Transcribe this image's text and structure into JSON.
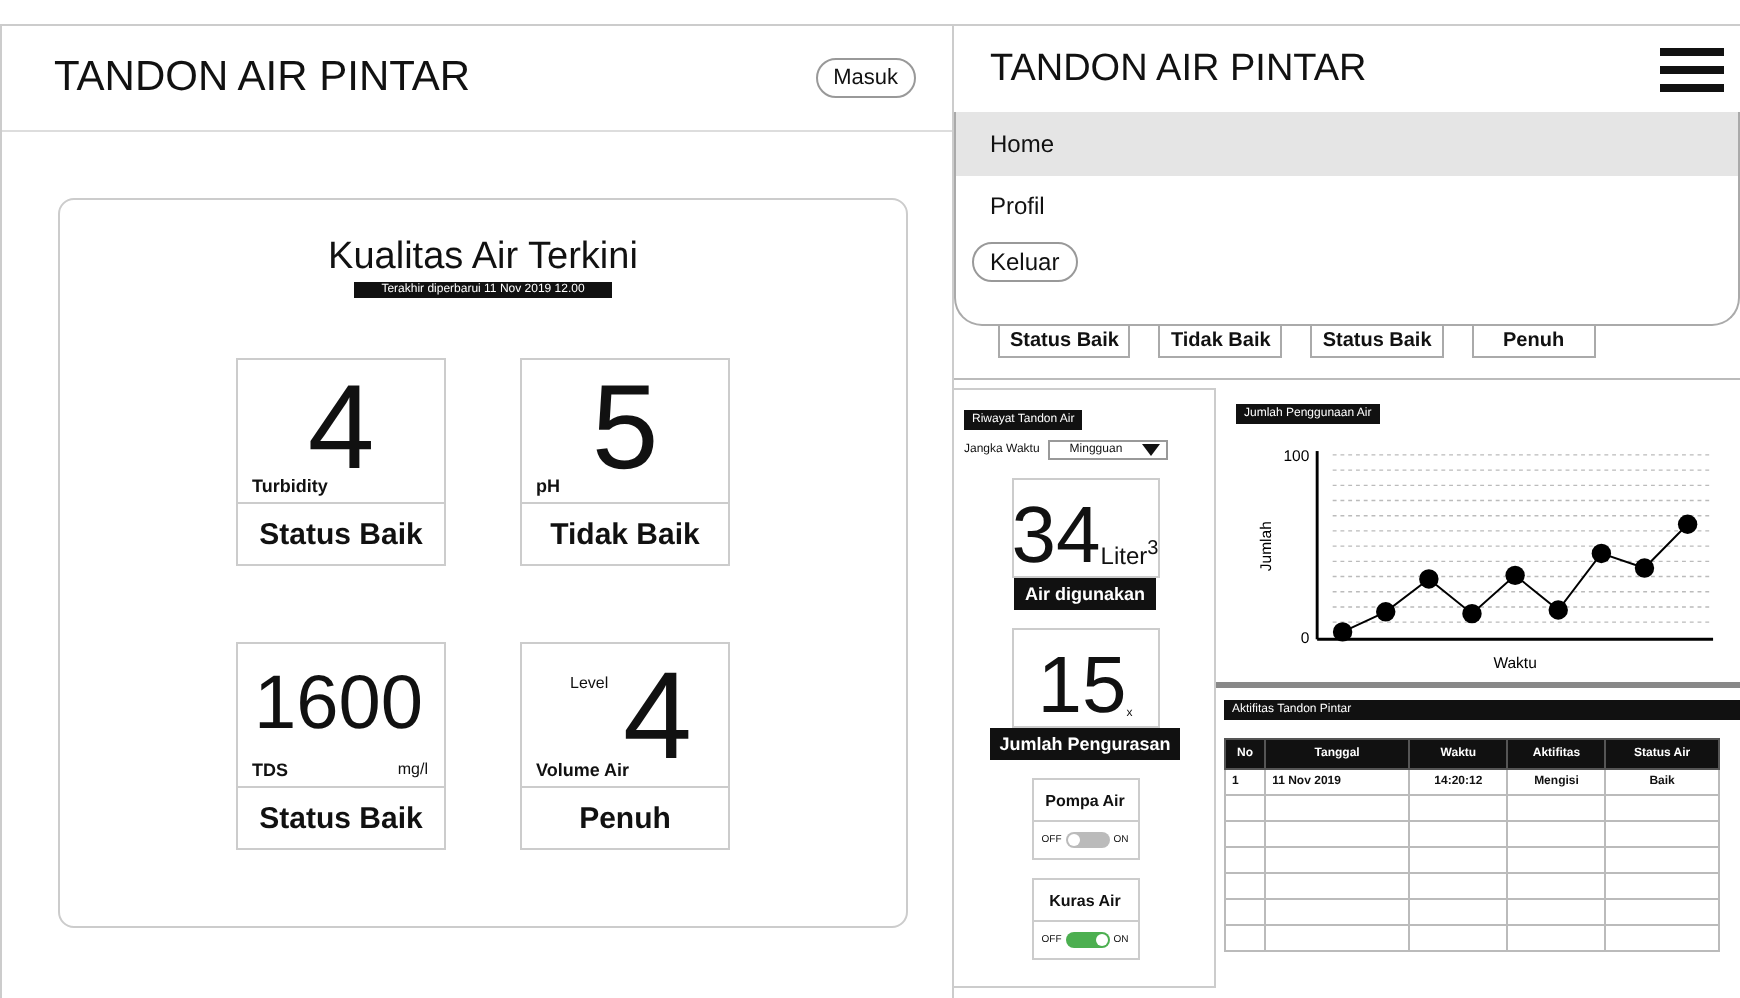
{
  "web_view": {
    "title": "TANDON AIR PINTAR",
    "login_button": "Masuk",
    "card": {
      "title": "Kualitas Air Terkini",
      "updated": "Terakhir diperbarui 11 Nov 2019 12.00",
      "tiles": [
        {
          "kind": "center",
          "value": "4",
          "label": "Turbidity",
          "status": "Status Baik"
        },
        {
          "kind": "center",
          "value": "5",
          "label": "pH",
          "status": "Tidak Baik"
        },
        {
          "kind": "unit",
          "value": "1600",
          "unit": "mg/l",
          "label": "TDS",
          "status": "Status Baik"
        },
        {
          "kind": "prefix",
          "value": "4",
          "prefix": "Level",
          "label": "Volume Air",
          "status": "Penuh"
        }
      ]
    }
  },
  "mobile_view": {
    "title": "TANDON AIR PINTAR",
    "menu": {
      "items": [
        {
          "label": "Home",
          "selected": true
        },
        {
          "label": "Profil",
          "selected": false
        }
      ],
      "logout_button": "Keluar"
    },
    "status_row": [
      "Status Baik",
      "Tidak Baik",
      "Status Baik",
      "Penuh"
    ],
    "history": {
      "title": "Riwayat Tandon Air",
      "period_label": "Jangka Waktu",
      "period_value": "Mingguan",
      "stats": [
        {
          "value": "34",
          "unit": "Liter$^{3}$",
          "label": "Air digunakan"
        },
        {
          "value": "15",
          "unit": "x",
          "label": "Jumlah Pengurasan"
        }
      ],
      "switches": [
        {
          "label": "Pompa Air",
          "off_label": "OFF",
          "on_label": "ON",
          "on": false
        },
        {
          "label": "Kuras Air",
          "off_label": "OFF",
          "on_label": "ON",
          "on": true
        }
      ]
    },
    "usage": {
      "title": "Jumlah Penggunaan Air",
      "chart_data": {
        "type": "line",
        "xlabel": "Waktu",
        "ylabel": "Jumlah",
        "categories": [
          null,
          null,
          null,
          null,
          null,
          null,
          null,
          null,
          null
        ],
        "ylim": [
          0,
          100
        ],
        "yticks": [
          0,
          100
        ],
        "series": [
          {
            "color": "#000000",
            "marker": "circle",
            "values": [
              3,
              14,
              32,
              13,
              34,
              15,
              46,
              38,
              62
            ]
          }
        ]
      }
    },
    "activity": {
      "title": "Aktifitas Tandon Pintar",
      "columns": [
        "No",
        "Tanggal",
        "Waktu",
        "Aktifitas",
        "Status Air"
      ],
      "rows": [
        [
          "1",
          "11 Nov 2019",
          "14:20:12",
          "Mengisi",
          "Baik"
        ]
      ]
    }
  }
}
